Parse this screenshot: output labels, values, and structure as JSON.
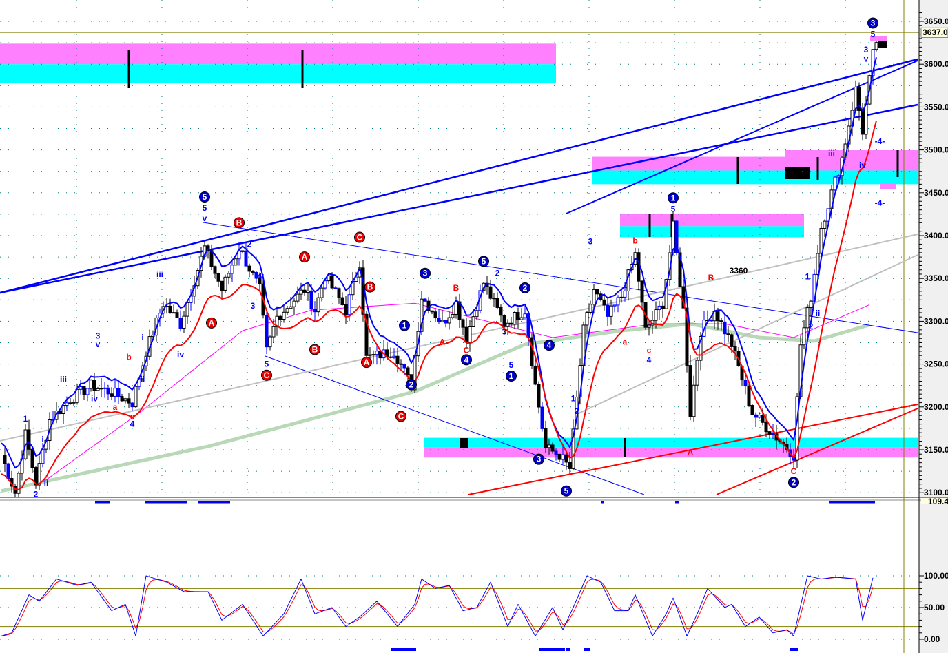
{
  "chart_data": {
    "type": "line",
    "subtype": "candlestick-with-elliott-wave-annotations",
    "price_axis": {
      "ticks": [
        "3650.0",
        "3600.0",
        "3550.0",
        "3500.0",
        "3450.0",
        "3400.0",
        "3350.0",
        "3300.0",
        "3250.0",
        "3200.0",
        "3150.0",
        "3100.0"
      ],
      "range": [
        3100,
        3660
      ]
    },
    "last_price_label": "3637.0",
    "last_price": 3637,
    "oscillator_axis": {
      "ticks": [
        "100.00",
        "50.00",
        "0.00"
      ],
      "range": [
        0,
        100
      ],
      "levels": [
        20,
        80
      ]
    },
    "oscillator_value_label": "109.4",
    "close_waypoints": [
      {
        "bar": 0,
        "close": 3144
      },
      {
        "bar": 4,
        "close": 3100
      },
      {
        "bar": 7,
        "close": 3168
      },
      {
        "bar": 10,
        "close": 3112
      },
      {
        "bar": 14,
        "close": 3185
      },
      {
        "bar": 20,
        "close": 3209
      },
      {
        "bar": 26,
        "close": 3225
      },
      {
        "bar": 32,
        "close": 3217
      },
      {
        "bar": 38,
        "close": 3205
      },
      {
        "bar": 42,
        "close": 3265
      },
      {
        "bar": 47,
        "close": 3321
      },
      {
        "bar": 52,
        "close": 3297
      },
      {
        "bar": 59,
        "close": 3386
      },
      {
        "bar": 64,
        "close": 3337
      },
      {
        "bar": 69,
        "close": 3386
      },
      {
        "bar": 75,
        "close": 3337
      },
      {
        "bar": 77,
        "close": 3265
      },
      {
        "bar": 80,
        "close": 3305
      },
      {
        "bar": 88,
        "close": 3337
      },
      {
        "bar": 91,
        "close": 3313
      },
      {
        "bar": 94,
        "close": 3353
      },
      {
        "bar": 100,
        "close": 3313
      },
      {
        "bar": 104,
        "close": 3369
      },
      {
        "bar": 106,
        "close": 3257
      },
      {
        "bar": 114,
        "close": 3265
      },
      {
        "bar": 119,
        "close": 3225
      },
      {
        "bar": 122,
        "close": 3329
      },
      {
        "bar": 128,
        "close": 3297
      },
      {
        "bar": 132,
        "close": 3321
      },
      {
        "bar": 135,
        "close": 3281
      },
      {
        "bar": 140,
        "close": 3345
      },
      {
        "bar": 146,
        "close": 3297
      },
      {
        "bar": 152,
        "close": 3313
      },
      {
        "bar": 155,
        "close": 3225
      },
      {
        "bar": 158,
        "close": 3152
      },
      {
        "bar": 162,
        "close": 3144
      },
      {
        "bar": 165,
        "close": 3128
      },
      {
        "bar": 167,
        "close": 3209
      },
      {
        "bar": 169,
        "close": 3289
      },
      {
        "bar": 172,
        "close": 3337
      },
      {
        "bar": 176,
        "close": 3305
      },
      {
        "bar": 180,
        "close": 3329
      },
      {
        "bar": 184,
        "close": 3378
      },
      {
        "bar": 187,
        "close": 3289
      },
      {
        "bar": 192,
        "close": 3321
      },
      {
        "bar": 195,
        "close": 3410
      },
      {
        "bar": 198,
        "close": 3313
      },
      {
        "bar": 200,
        "close": 3193
      },
      {
        "bar": 203,
        "close": 3289
      },
      {
        "bar": 207,
        "close": 3313
      },
      {
        "bar": 212,
        "close": 3273
      },
      {
        "bar": 218,
        "close": 3193
      },
      {
        "bar": 224,
        "close": 3169
      },
      {
        "bar": 230,
        "close": 3144
      },
      {
        "bar": 232,
        "close": 3273
      },
      {
        "bar": 235,
        "close": 3329
      },
      {
        "bar": 238,
        "close": 3410
      },
      {
        "bar": 241,
        "close": 3450
      },
      {
        "bar": 244,
        "close": 3490
      },
      {
        "bar": 248,
        "close": 3570
      },
      {
        "bar": 250,
        "close": 3522
      },
      {
        "bar": 253,
        "close": 3611
      },
      {
        "bar": 254,
        "close": 3627
      }
    ],
    "moving_average_green": [
      {
        "bar": 0,
        "v": 3102
      },
      {
        "bar": 60,
        "v": 3154
      },
      {
        "bar": 120,
        "v": 3218
      },
      {
        "bar": 152,
        "v": 3273
      },
      {
        "bar": 180,
        "v": 3289
      },
      {
        "bar": 200,
        "v": 3297
      },
      {
        "bar": 220,
        "v": 3281
      },
      {
        "bar": 236,
        "v": 3277
      },
      {
        "bar": 253,
        "v": 3297
      }
    ],
    "moving_average_magenta": [
      {
        "bar": 12,
        "v": 3112
      },
      {
        "bar": 40,
        "v": 3193
      },
      {
        "bar": 70,
        "v": 3289
      },
      {
        "bar": 90,
        "v": 3313
      },
      {
        "bar": 120,
        "v": 3321
      },
      {
        "bar": 160,
        "v": 3281
      },
      {
        "bar": 190,
        "v": 3297
      },
      {
        "bar": 210,
        "v": 3297
      },
      {
        "bar": 230,
        "v": 3281
      },
      {
        "bar": 253,
        "v": 3321
      }
    ],
    "zones": [
      {
        "name": "upper-resistance",
        "from_bar": 0,
        "to_bar": 161,
        "magenta": [
          3600,
          3624
        ],
        "cyan": [
          3578,
          3600
        ]
      },
      {
        "name": "mid-resistance",
        "from_bar": 172,
        "to_bar": 266,
        "magenta": [
          3476,
          3492
        ],
        "cyan": [
          3460,
          3476
        ]
      },
      {
        "name": "small-zone",
        "from_bar": 180,
        "to_bar": 233,
        "magenta": [
          3411,
          3425
        ],
        "cyan": [
          3398,
          3411
        ]
      },
      {
        "name": "support",
        "from_bar": 123,
        "to_bar": 266,
        "magenta": [
          3141,
          3153
        ],
        "cyan": [
          3153,
          3164
        ]
      }
    ],
    "annotations": [
      {
        "t": "5",
        "bar": 59,
        "p": 3445,
        "c": "blue",
        "circle": true
      },
      {
        "t": "3",
        "bar": 123,
        "p": 3356,
        "c": "blue",
        "circle": true
      },
      {
        "t": "5",
        "bar": 140,
        "p": 3370,
        "c": "blue",
        "circle": true
      },
      {
        "t": "2",
        "bar": 152,
        "p": 3339,
        "c": "blue",
        "circle": true
      },
      {
        "t": "1",
        "bar": 117,
        "p": 3295,
        "c": "blue",
        "circle": true
      },
      {
        "t": "4",
        "bar": 135,
        "p": 3255,
        "c": "blue",
        "circle": true
      },
      {
        "t": "2",
        "bar": 119,
        "p": 3226,
        "c": "blue",
        "circle": true
      },
      {
        "t": "4",
        "bar": 159,
        "p": 3272,
        "c": "blue",
        "circle": true
      },
      {
        "t": "1",
        "bar": 148,
        "p": 3236,
        "c": "blue",
        "circle": true
      },
      {
        "t": "3",
        "bar": 156,
        "p": 3139,
        "c": "blue",
        "circle": true
      },
      {
        "t": "5",
        "bar": 164,
        "p": 3102,
        "c": "blue",
        "circle": true
      },
      {
        "t": "1",
        "bar": 195,
        "p": 3444,
        "c": "blue",
        "circle": true
      },
      {
        "t": "3",
        "bar": 253,
        "p": 3648,
        "c": "blue",
        "circle": true
      },
      {
        "t": "2",
        "bar": 230,
        "p": 3112,
        "c": "blue",
        "circle": true
      },
      {
        "t": "B",
        "bar": 69,
        "p": 3415,
        "c": "red",
        "circle": true
      },
      {
        "t": "C",
        "bar": 104,
        "p": 3398,
        "c": "red",
        "circle": true
      },
      {
        "t": "A",
        "bar": 88,
        "p": 3375,
        "c": "red",
        "circle": true
      },
      {
        "t": "B",
        "bar": 107,
        "p": 3340,
        "c": "red",
        "circle": true
      },
      {
        "t": "A",
        "bar": 61,
        "p": 3298,
        "c": "red",
        "circle": true
      },
      {
        "t": "B",
        "bar": 91,
        "p": 3267,
        "c": "red",
        "circle": true
      },
      {
        "t": "A",
        "bar": 106,
        "p": 3252,
        "c": "red",
        "circle": true
      },
      {
        "t": "C",
        "bar": 77,
        "p": 3237,
        "c": "red",
        "circle": true
      },
      {
        "t": "C",
        "bar": 116,
        "p": 3189,
        "c": "red",
        "circle": true
      },
      {
        "t": "5",
        "bar": 59,
        "p": 3432,
        "c": "blue"
      },
      {
        "t": "v",
        "bar": 59,
        "p": 3420,
        "c": "blue"
      },
      {
        "t": "3",
        "bar": 28,
        "p": 3283,
        "c": "blue"
      },
      {
        "t": "v",
        "bar": 28,
        "p": 3273,
        "c": "blue"
      },
      {
        "t": "iii",
        "bar": 18,
        "p": 3232,
        "c": "blue"
      },
      {
        "t": "iv",
        "bar": 27,
        "p": 3210,
        "c": "blue"
      },
      {
        "t": "iii",
        "bar": 46,
        "p": 3355,
        "c": "blue"
      },
      {
        "t": "iv",
        "bar": 52,
        "p": 3261,
        "c": "blue"
      },
      {
        "t": "i",
        "bar": 41,
        "p": 3281,
        "c": "blue"
      },
      {
        "t": "ii",
        "bar": 41,
        "p": 3232,
        "c": "blue"
      },
      {
        "t": "1",
        "bar": 7,
        "p": 3186,
        "c": "blue"
      },
      {
        "t": "i",
        "bar": 12,
        "p": 3162,
        "c": "blue"
      },
      {
        "t": "ii",
        "bar": 13,
        "p": 3111,
        "c": "blue"
      },
      {
        "t": "2",
        "bar": 10,
        "p": 3098,
        "c": "blue"
      },
      {
        "t": "4",
        "bar": 38,
        "p": 3180,
        "c": "blue"
      },
      {
        "t": "2",
        "bar": 72,
        "p": 3390,
        "c": "blue"
      },
      {
        "t": "4",
        "bar": 75,
        "p": 3353,
        "c": "blue"
      },
      {
        "t": "3",
        "bar": 73,
        "p": 3318,
        "c": "blue"
      },
      {
        "t": "5",
        "bar": 77,
        "p": 3250,
        "c": "blue"
      },
      {
        "t": "2",
        "bar": 144,
        "p": 3356,
        "c": "blue"
      },
      {
        "t": "3",
        "bar": 146,
        "p": 3288,
        "c": "blue"
      },
      {
        "t": "5",
        "bar": 148,
        "p": 3249,
        "c": "blue"
      },
      {
        "t": "3",
        "bar": 171,
        "p": 3393,
        "c": "blue"
      },
      {
        "t": "5",
        "bar": 195,
        "p": 3431,
        "c": "blue"
      },
      {
        "t": "4",
        "bar": 188,
        "p": 3255,
        "c": "blue"
      },
      {
        "t": "1",
        "bar": 166,
        "p": 3210,
        "c": "blue"
      },
      {
        "t": "2",
        "bar": 167,
        "p": 3195,
        "c": "blue"
      },
      {
        "t": "1",
        "bar": 234,
        "p": 3352,
        "c": "blue"
      },
      {
        "t": "i",
        "bar": 237,
        "p": 3345,
        "c": "blue"
      },
      {
        "t": "2",
        "bar": 235,
        "p": 3294,
        "c": "blue"
      },
      {
        "t": "ii",
        "bar": 237,
        "p": 3309,
        "c": "blue"
      },
      {
        "t": "iii",
        "bar": 241,
        "p": 3496,
        "c": "blue"
      },
      {
        "t": "iv",
        "bar": 250,
        "p": 3482,
        "c": "blue"
      },
      {
        "t": "3",
        "bar": 251,
        "p": 3617,
        "c": "blue"
      },
      {
        "t": "v",
        "bar": 251,
        "p": 3606,
        "c": "blue"
      },
      {
        "t": "-4-",
        "bar": 255,
        "p": 3510,
        "c": "blue"
      },
      {
        "t": "-4-",
        "bar": 255,
        "p": 3438,
        "c": "blue"
      },
      {
        "t": "5",
        "bar": 253,
        "p": 3635,
        "c": "blue"
      },
      {
        "t": "a",
        "bar": 33,
        "p": 3200,
        "c": "red"
      },
      {
        "t": "b",
        "bar": 37,
        "p": 3258,
        "c": "red"
      },
      {
        "t": "c",
        "bar": 38,
        "p": 3189,
        "c": "red"
      },
      {
        "t": "A",
        "bar": 128,
        "p": 3276,
        "c": "red"
      },
      {
        "t": "B",
        "bar": 132,
        "p": 3339,
        "c": "red"
      },
      {
        "t": "C",
        "bar": 135,
        "p": 3266,
        "c": "red"
      },
      {
        "t": "b",
        "bar": 184,
        "p": 3394,
        "c": "red"
      },
      {
        "t": "a",
        "bar": 181,
        "p": 3276,
        "c": "red"
      },
      {
        "t": "c",
        "bar": 188,
        "p": 3266,
        "c": "red"
      },
      {
        "t": "B",
        "bar": 206,
        "p": 3351,
        "c": "red"
      },
      {
        "t": "A",
        "bar": 200,
        "p": 3147,
        "c": "red"
      },
      {
        "t": "C",
        "bar": 230,
        "p": 3125,
        "c": "red"
      },
      {
        "t": "3360",
        "bar": 214,
        "p": 3359,
        "c": "black"
      }
    ],
    "oscillator_waypoints": [
      [
        0,
        5
      ],
      [
        3,
        10
      ],
      [
        8,
        70
      ],
      [
        11,
        60
      ],
      [
        16,
        95
      ],
      [
        22,
        85
      ],
      [
        26,
        90
      ],
      [
        32,
        45
      ],
      [
        36,
        55
      ],
      [
        39,
        5
      ],
      [
        42,
        100
      ],
      [
        48,
        90
      ],
      [
        53,
        75
      ],
      [
        60,
        75
      ],
      [
        64,
        30
      ],
      [
        70,
        55
      ],
      [
        76,
        5
      ],
      [
        82,
        40
      ],
      [
        87,
        95
      ],
      [
        91,
        40
      ],
      [
        96,
        50
      ],
      [
        100,
        20
      ],
      [
        104,
        35
      ],
      [
        109,
        60
      ],
      [
        115,
        20
      ],
      [
        120,
        55
      ],
      [
        122,
        95
      ],
      [
        126,
        80
      ],
      [
        130,
        85
      ],
      [
        134,
        45
      ],
      [
        138,
        50
      ],
      [
        142,
        90
      ],
      [
        147,
        20
      ],
      [
        150,
        55
      ],
      [
        155,
        5
      ],
      [
        160,
        50
      ],
      [
        163,
        15
      ],
      [
        166,
        50
      ],
      [
        170,
        100
      ],
      [
        174,
        90
      ],
      [
        178,
        45
      ],
      [
        182,
        45
      ],
      [
        184,
        70
      ],
      [
        189,
        5
      ],
      [
        193,
        40
      ],
      [
        195,
        65
      ],
      [
        199,
        5
      ],
      [
        202,
        40
      ],
      [
        205,
        80
      ],
      [
        210,
        50
      ],
      [
        212,
        55
      ],
      [
        216,
        20
      ],
      [
        220,
        35
      ],
      [
        224,
        10
      ],
      [
        228,
        15
      ],
      [
        230,
        5
      ],
      [
        234,
        100
      ],
      [
        238,
        95
      ],
      [
        242,
        98
      ],
      [
        248,
        95
      ],
      [
        250,
        30
      ],
      [
        253,
        97
      ]
    ],
    "colors": {
      "up": "#ffffff",
      "down": "#000000",
      "wave_blue": "#0000ff",
      "wave_red": "#ff0000",
      "magenta": "#ff80ff",
      "cyan": "#00ffff",
      "grid": "#008080",
      "level": "#808000",
      "ma_green": "#b8d8b8",
      "ma_gray": "#c0c0c0"
    }
  }
}
